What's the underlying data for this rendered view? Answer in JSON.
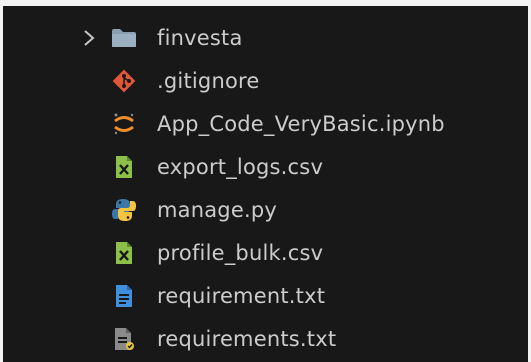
{
  "explorer": {
    "items": [
      {
        "label": "finvesta",
        "kind": "folder",
        "icon": "folder-icon",
        "expanded": false
      },
      {
        "label": ".gitignore",
        "kind": "file",
        "icon": "git-icon",
        "color": "#e2573a"
      },
      {
        "label": "App_Code_VeryBasic.ipynb",
        "kind": "file",
        "icon": "jupyter-icon",
        "color": "#f08d2b"
      },
      {
        "label": "export_logs.csv",
        "kind": "file",
        "icon": "csv-icon",
        "color": "#8cc04a"
      },
      {
        "label": "manage.py",
        "kind": "file",
        "icon": "python-icon",
        "color": "#3b77a8"
      },
      {
        "label": "profile_bulk.csv",
        "kind": "file",
        "icon": "csv-icon",
        "color": "#8cc04a"
      },
      {
        "label": "requirement.txt",
        "kind": "file",
        "icon": "text-file-icon",
        "color": "#3f8fdc"
      },
      {
        "label": "requirements.txt",
        "kind": "file",
        "icon": "requirements-icon",
        "color": "#8a8a8a"
      }
    ]
  },
  "theme": {
    "background": "#181818",
    "text": "#cccccc",
    "frame": "#f2f2f2"
  }
}
